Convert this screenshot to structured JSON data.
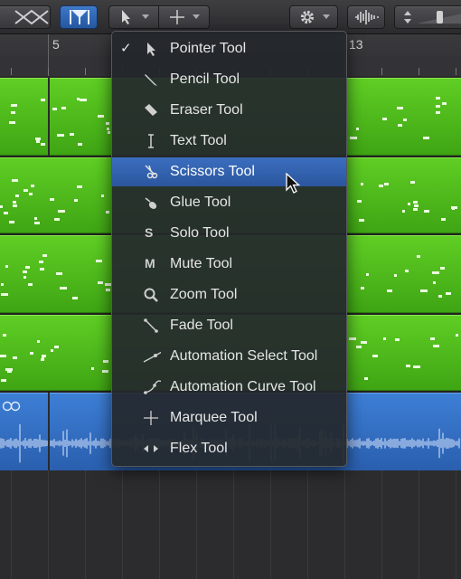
{
  "ruler": {
    "bars": [
      "5",
      "13"
    ]
  },
  "menu": {
    "selected": "Pointer Tool",
    "highlighted": "Scissors Tool",
    "items": [
      {
        "label": "Pointer Tool",
        "icon": "pointer-icon"
      },
      {
        "label": "Pencil Tool",
        "icon": "pencil-icon"
      },
      {
        "label": "Eraser Tool",
        "icon": "eraser-icon"
      },
      {
        "label": "Text Tool",
        "icon": "text-cursor-icon"
      },
      {
        "label": "Scissors Tool",
        "icon": "scissors-icon"
      },
      {
        "label": "Glue Tool",
        "icon": "glue-icon"
      },
      {
        "label": "Solo Tool",
        "icon": "solo-icon",
        "glyph": "S"
      },
      {
        "label": "Mute Tool",
        "icon": "mute-icon",
        "glyph": "M"
      },
      {
        "label": "Zoom Tool",
        "icon": "zoom-icon"
      },
      {
        "label": "Fade Tool",
        "icon": "fade-icon"
      },
      {
        "label": "Automation Select Tool",
        "icon": "automation-select-icon"
      },
      {
        "label": "Automation Curve Tool",
        "icon": "automation-curve-icon"
      },
      {
        "label": "Marquee Tool",
        "icon": "marquee-icon"
      },
      {
        "label": "Flex Tool",
        "icon": "flex-icon"
      }
    ]
  },
  "check_mark": "✓",
  "colors": {
    "midi_region": "#4fba1c",
    "audio_region": "#3470c4",
    "menu_highlight": "#3466b5"
  }
}
